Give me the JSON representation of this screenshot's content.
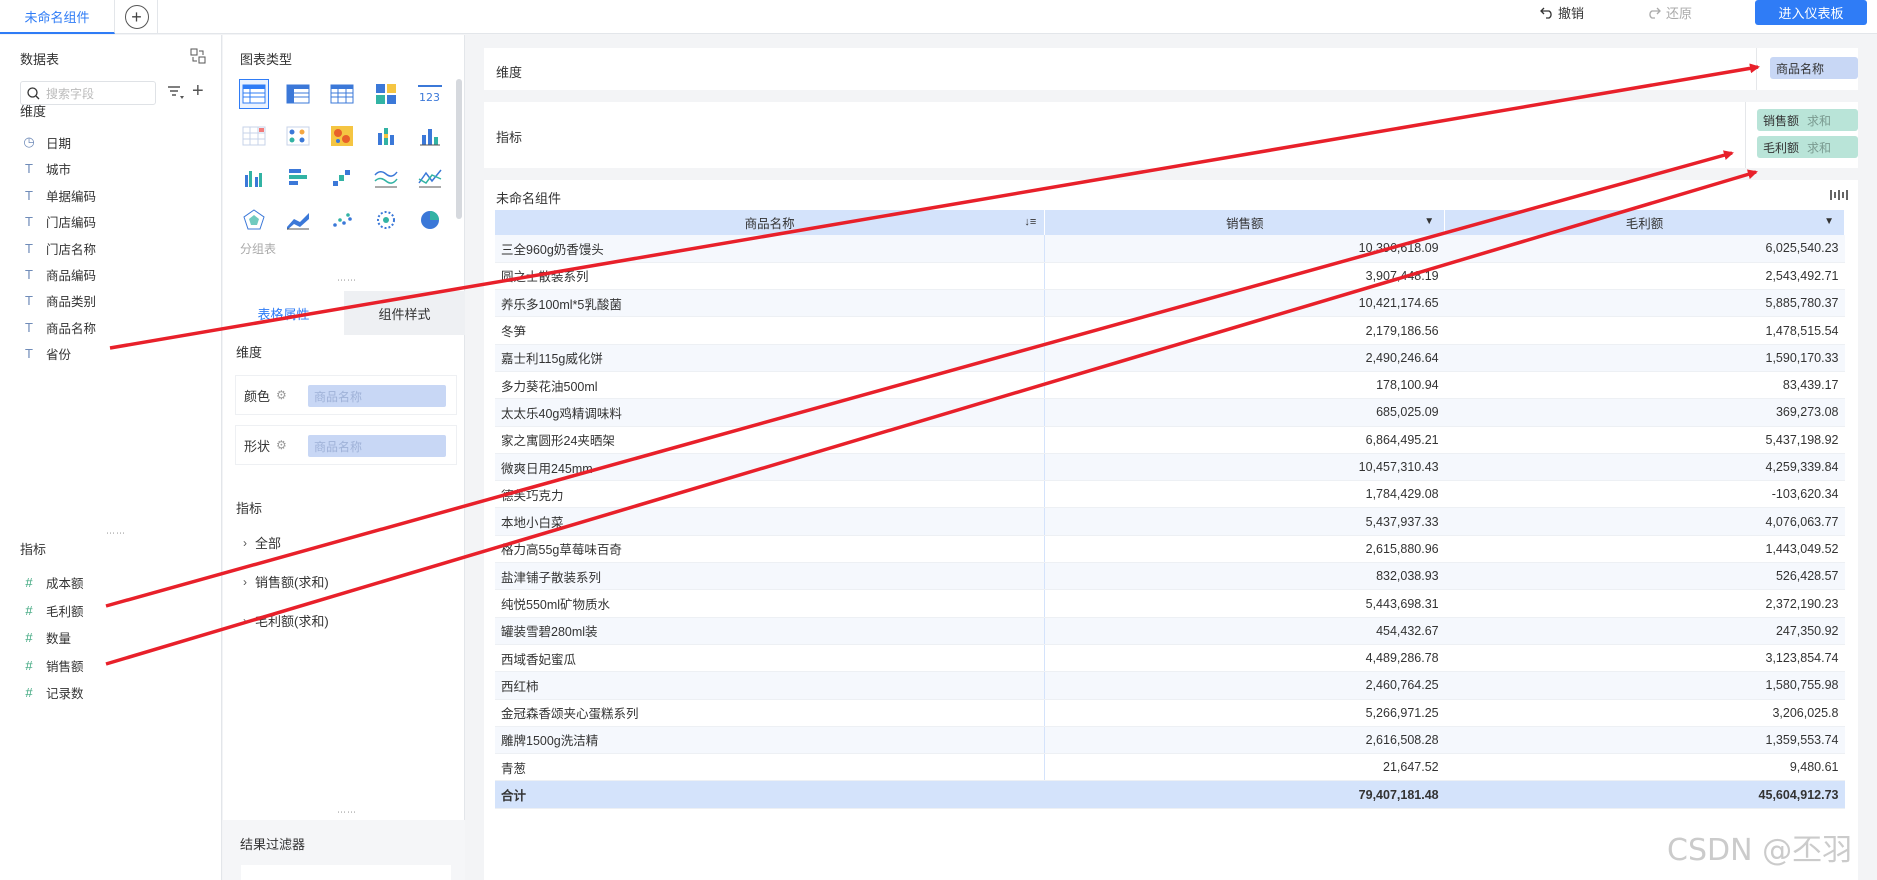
{
  "topbar": {
    "tab_label": "未命名组件",
    "undo_label": "撤销",
    "redo_label": "还原",
    "enter_label": "进入仪表板"
  },
  "left": {
    "table_header": "数据表",
    "search_placeholder": "搜索字段",
    "dimension_label": "维度",
    "dimensions": [
      "日期",
      "城市",
      "单据编码",
      "门店编码",
      "门店名称",
      "商品编码",
      "商品类别",
      "商品名称",
      "省份"
    ],
    "metric_label": "指标",
    "metrics": [
      "成本额",
      "毛利额",
      "数量",
      "销售额",
      "记录数"
    ]
  },
  "mid": {
    "chart_type_label": "图表类型",
    "group_table_label": "分组表",
    "tab_table_props": "表格属性",
    "tab_component_style": "组件样式",
    "dimension_label": "维度",
    "color_label": "颜色",
    "shape_label": "形状",
    "chip_placeholder": "商品名称",
    "metric_label": "指标",
    "tree_all": "全部",
    "tree_sales": "销售额(求和)",
    "tree_profit": "毛利额(求和)",
    "result_filter_label": "结果过滤器"
  },
  "main": {
    "dimension_zone_label": "维度",
    "dimension_chip": "商品名称",
    "metric_zone_label": "指标",
    "metric_chips": [
      {
        "name": "销售额",
        "agg": "求和"
      },
      {
        "name": "毛利额",
        "agg": "求和"
      }
    ],
    "component_title": "未命名组件"
  },
  "table": {
    "columns": [
      "商品名称",
      "销售额",
      "毛利额"
    ],
    "rows": [
      [
        "三全960g奶香馒头",
        "10,396,618.09",
        "6,025,540.23"
      ],
      [
        "圆之士散装系列",
        "3,907,448.19",
        "2,543,492.71"
      ],
      [
        "养乐多100ml*5乳酸菌",
        "10,421,174.65",
        "5,885,780.37"
      ],
      [
        "冬笋",
        "2,179,186.56",
        "1,478,515.54"
      ],
      [
        "嘉士利115g威化饼",
        "2,490,246.64",
        "1,590,170.33"
      ],
      [
        "多力葵花油500ml",
        "178,100.94",
        "83,439.17"
      ],
      [
        "太太乐40g鸡精调味料",
        "685,025.09",
        "369,273.08"
      ],
      [
        "家之寓圆形24夹晒架",
        "6,864,495.21",
        "5,437,198.92"
      ],
      [
        "微爽日用245mm",
        "10,457,310.43",
        "4,259,339.84"
      ],
      [
        "德芙巧克力",
        "1,784,429.08",
        "-103,620.34"
      ],
      [
        "本地小白菜",
        "5,437,937.33",
        "4,076,063.77"
      ],
      [
        "格力高55g草莓味百奇",
        "2,615,880.96",
        "1,443,049.52"
      ],
      [
        "盐津铺子散装系列",
        "832,038.93",
        "526,428.57"
      ],
      [
        "纯悦550ml矿物质水",
        "5,443,698.31",
        "2,372,190.23"
      ],
      [
        "罐装雪碧280ml装",
        "454,432.67",
        "247,350.92"
      ],
      [
        "西域香妃蜜瓜",
        "4,489,286.78",
        "3,123,854.74"
      ],
      [
        "西红柿",
        "2,460,764.25",
        "1,580,755.98"
      ],
      [
        "金冠森香颂夹心蛋糕系列",
        "5,266,971.25",
        "3,206,025.8"
      ],
      [
        "雕牌1500g洗洁精",
        "2,616,508.28",
        "1,359,553.74"
      ],
      [
        "青葱",
        "21,647.52",
        "9,480.61"
      ]
    ],
    "total": [
      "合计",
      "79,407,181.48",
      "45,604,912.73"
    ]
  },
  "watermark": "CSDN @丕羽",
  "colors": {
    "accent": "#2f7cf6",
    "arrow": "#e8202a",
    "header_bg": "#d4e3fb",
    "metric_chip": "#b9e4d8"
  }
}
